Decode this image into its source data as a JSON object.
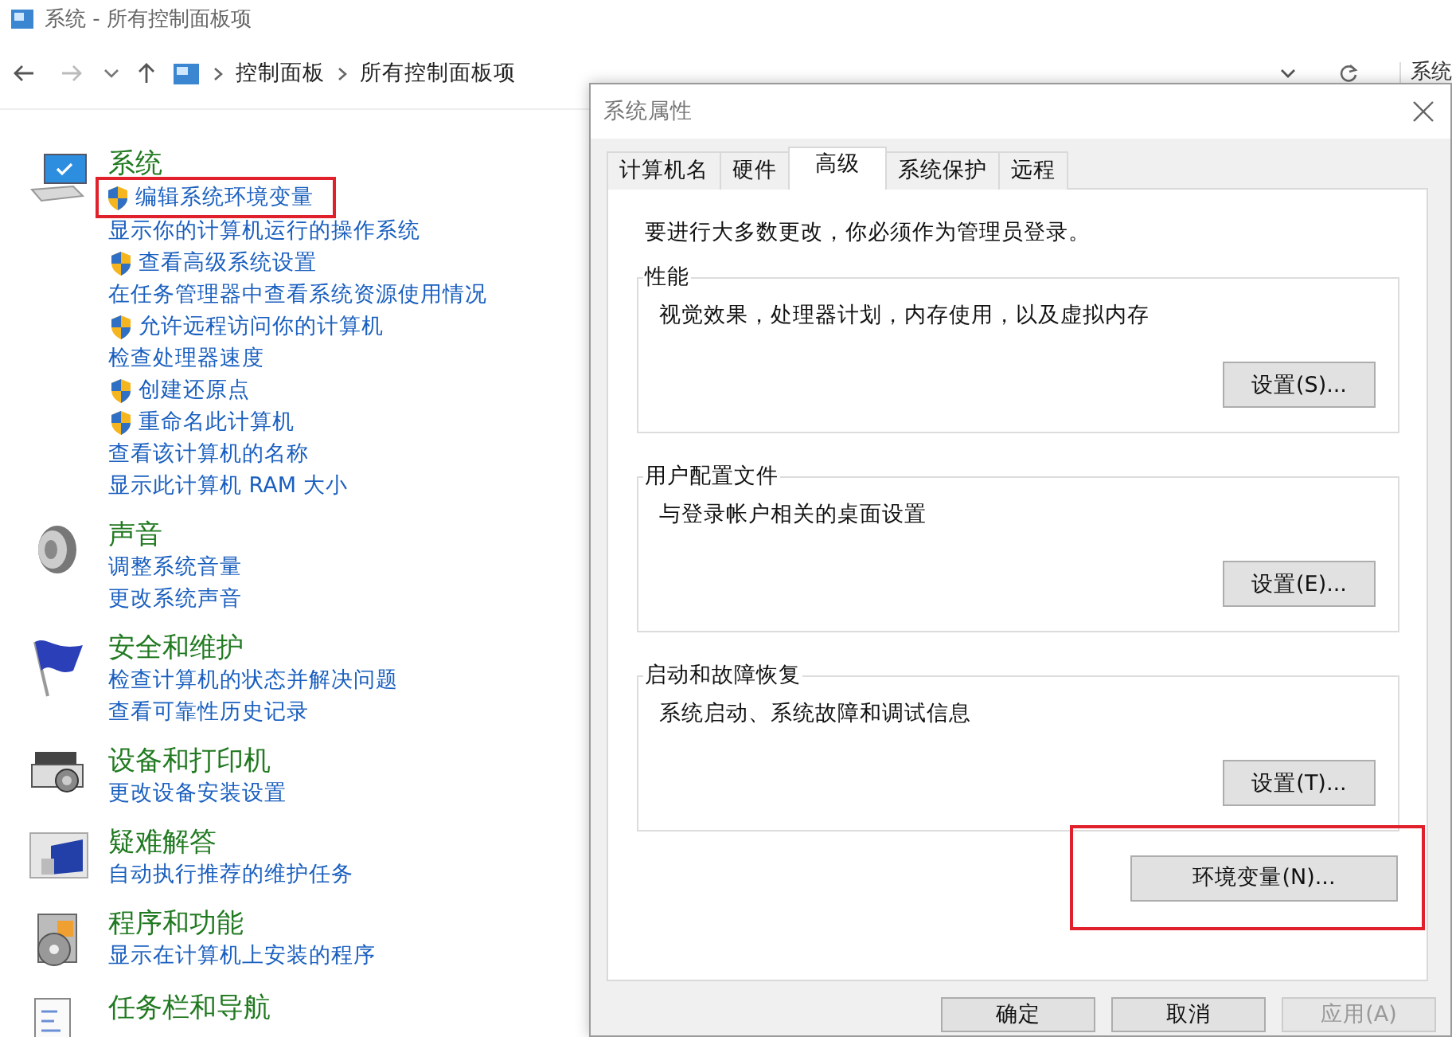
{
  "window": {
    "title": "系统 - 所有控制面板项"
  },
  "breadcrumb": [
    "控制面板",
    "所有控制面板项"
  ],
  "search": {
    "value": "系统"
  },
  "categories": [
    {
      "kind": "system",
      "title": "系统",
      "links": [
        {
          "text": "编辑系统环境变量",
          "shield": true,
          "highlighted": true
        },
        {
          "text": "显示你的计算机运行的操作系统",
          "shield": false,
          "highlighted": false
        },
        {
          "text": "查看高级系统设置",
          "shield": true,
          "highlighted": false
        },
        {
          "text": "在任务管理器中查看系统资源使用情况",
          "shield": false,
          "highlighted": false
        },
        {
          "text": "允许远程访问你的计算机",
          "shield": true,
          "highlighted": false
        },
        {
          "text": "检查处理器速度",
          "shield": false,
          "highlighted": false
        },
        {
          "text": "创建还原点",
          "shield": true,
          "highlighted": false
        },
        {
          "text": "重命名此计算机",
          "shield": true,
          "highlighted": false
        },
        {
          "text": "查看该计算机的名称",
          "shield": false,
          "highlighted": false
        },
        {
          "text": "显示此计算机 RAM 大小",
          "shield": false,
          "highlighted": false
        }
      ]
    },
    {
      "kind": "sound",
      "title": "声音",
      "links": [
        {
          "text": "调整系统音量",
          "shield": false,
          "highlighted": false
        },
        {
          "text": "更改系统声音",
          "shield": false,
          "highlighted": false
        }
      ]
    },
    {
      "kind": "security",
      "title": "安全和维护",
      "links": [
        {
          "text": "检查计算机的状态并解决问题",
          "shield": false,
          "highlighted": false
        },
        {
          "text": "查看可靠性历史记录",
          "shield": false,
          "highlighted": false
        }
      ]
    },
    {
      "kind": "devices",
      "title": "设备和打印机",
      "links": [
        {
          "text": "更改设备安装设置",
          "shield": false,
          "highlighted": false
        }
      ]
    },
    {
      "kind": "troubleshoot",
      "title": "疑难解答",
      "links": [
        {
          "text": "自动执行推荐的维护任务",
          "shield": false,
          "highlighted": false
        }
      ]
    },
    {
      "kind": "programs",
      "title": "程序和功能",
      "links": [
        {
          "text": "显示在计算机上安装的程序",
          "shield": false,
          "highlighted": false
        }
      ]
    },
    {
      "kind": "taskbar",
      "title": "任务栏和导航"
    }
  ],
  "dialog": {
    "title": "系统属性",
    "tabs": [
      {
        "label": "计算机名",
        "selected": false
      },
      {
        "label": "硬件",
        "selected": false
      },
      {
        "label": "高级",
        "selected": true
      },
      {
        "label": "系统保护",
        "selected": false
      },
      {
        "label": "远程",
        "selected": false
      }
    ],
    "notice": "要进行大多数更改，你必须作为管理员登录。",
    "groups": [
      {
        "legend": "性能",
        "description": "视觉效果，处理器计划，内存使用，以及虚拟内存",
        "button": "设置(S)..."
      },
      {
        "legend": "用户配置文件",
        "description": "与登录帐户相关的桌面设置",
        "button": "设置(E)..."
      },
      {
        "legend": "启动和故障恢复",
        "description": "系统启动、系统故障和调试信息",
        "button": "设置(T)..."
      }
    ],
    "env_button": {
      "label": "环境变量(N)...",
      "highlighted": true
    },
    "footer_buttons": [
      {
        "label": "确定",
        "disabled": false
      },
      {
        "label": "取消",
        "disabled": false
      },
      {
        "label": "应用(A)",
        "disabled": true
      }
    ]
  }
}
